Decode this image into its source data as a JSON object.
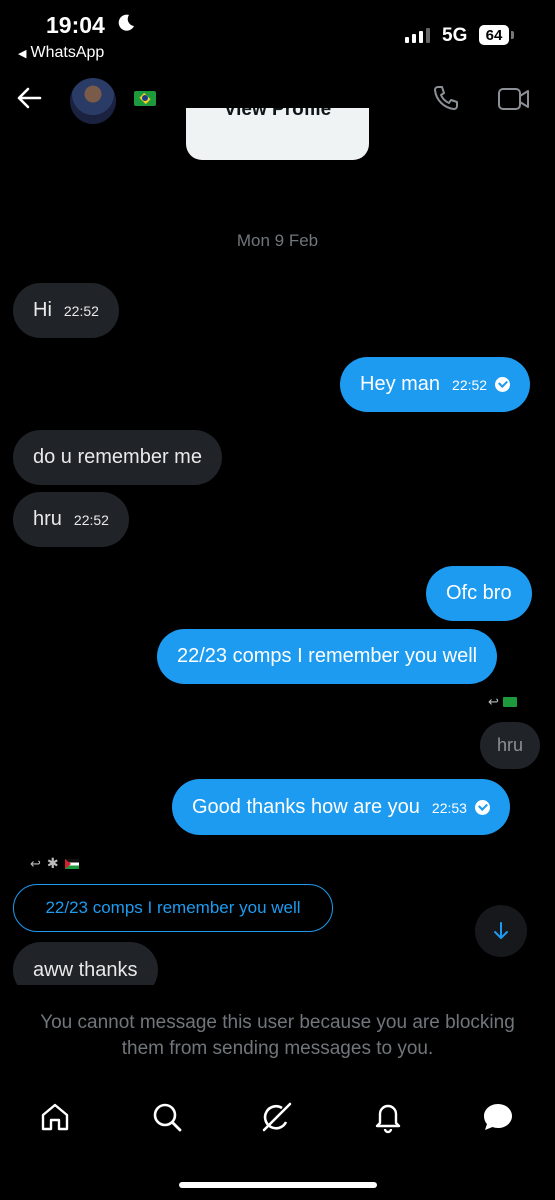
{
  "status_bar": {
    "time": "19:04",
    "back_app": "WhatsApp",
    "network": "5G",
    "battery": "64"
  },
  "header": {
    "avatar": "avatar",
    "flag": "brazil-flag",
    "icons": [
      "back-arrow-icon",
      "phone-icon",
      "video-icon"
    ]
  },
  "view_profile": "View Profile",
  "date_separator": "Mon 9 Feb",
  "messages": [
    {
      "dir": "in",
      "text": "Hi",
      "time": "22:52"
    },
    {
      "dir": "out",
      "text": "Hey man",
      "time": "22:52",
      "read": true
    },
    {
      "dir": "in",
      "text": "do u remember me",
      "time": ""
    },
    {
      "dir": "in",
      "text": "hru",
      "time": "22:52"
    },
    {
      "dir": "out",
      "text": "Ofc bro",
      "time": ""
    },
    {
      "dir": "out",
      "text": "22/23 comps I remember you well",
      "time": ""
    },
    {
      "dir": "out",
      "text": "Good thanks how are you",
      "time": "22:53",
      "read": true,
      "quoted": "hru"
    },
    {
      "dir": "in",
      "text": "aww thanks",
      "time": "",
      "quoted": "22/23 comps I remember you well"
    }
  ],
  "blocked_notice": "You cannot message this user because you are blocking them from sending messages to you.",
  "bottom_nav": [
    "home-icon",
    "search-icon",
    "grok-icon",
    "notifications-icon",
    "messages-icon"
  ],
  "colors": {
    "accent": "#1d9bf0",
    "incoming_bubble": "#202327",
    "background": "#000000"
  }
}
